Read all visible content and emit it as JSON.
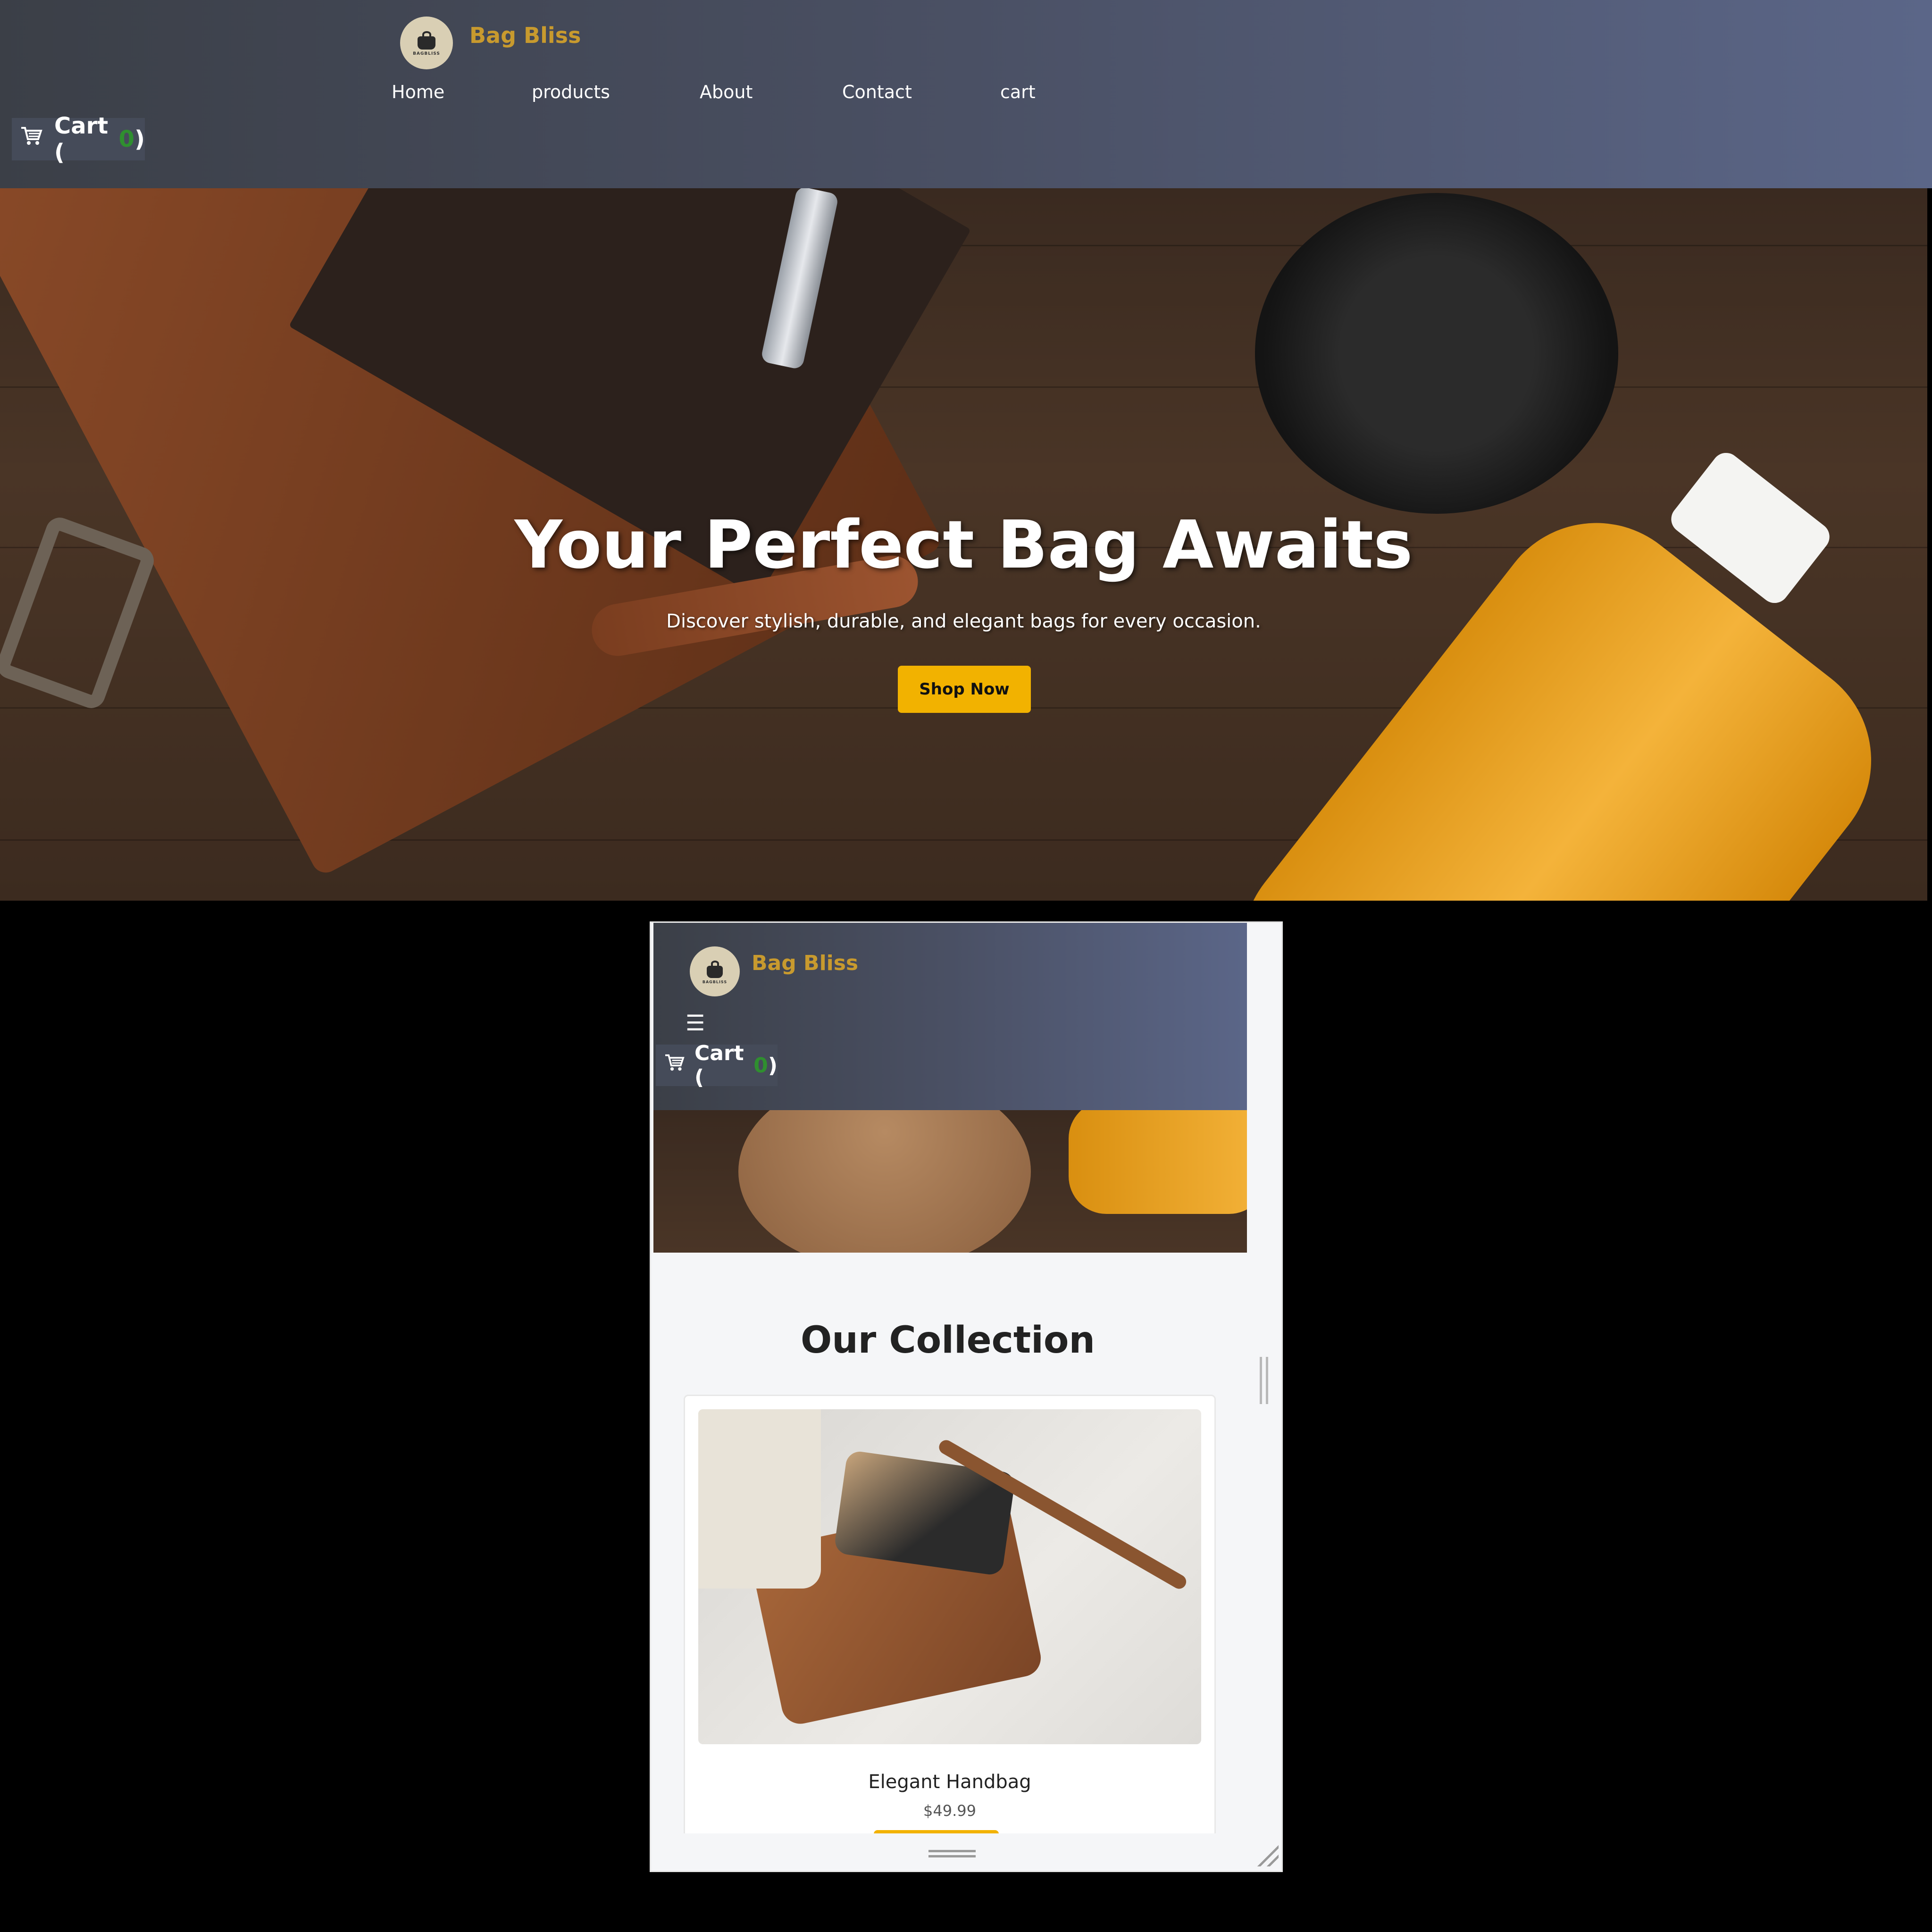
{
  "brand": {
    "name": "Bag Bliss",
    "logo_text": "BAGBLISS"
  },
  "nav": {
    "items": [
      "Home",
      "products",
      "About",
      "Contact",
      "cart"
    ]
  },
  "cart": {
    "label": "Cart (",
    "count": "0",
    "close": ")"
  },
  "hero": {
    "title": "Your Perfect Bag Awaits",
    "subtitle": "Discover stylish, durable, and elegant bags for every occasion.",
    "button": "Shop Now"
  },
  "mobile": {
    "menu_icon": "☰",
    "collection_title": "Our Collection",
    "product": {
      "name": "Elegant Handbag",
      "price": "$49.99"
    }
  },
  "icons": {
    "cart": "cart-icon",
    "menu": "hamburger-icon"
  },
  "colors": {
    "accent": "#f2b200",
    "brand": "#c89a2e",
    "header_start": "#3b3f47",
    "header_end": "#5b6688",
    "cart_count": "#2f8f2f"
  }
}
